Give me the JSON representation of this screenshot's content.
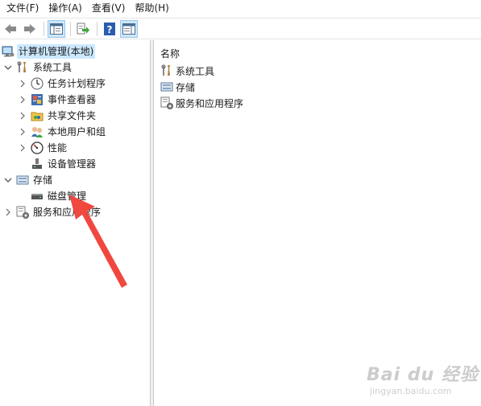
{
  "menubar": {
    "items": [
      {
        "label": "文件(F)"
      },
      {
        "label": "操作(A)"
      },
      {
        "label": "查看(V)"
      },
      {
        "label": "帮助(H)"
      }
    ]
  },
  "toolbar": {
    "buttons": [
      "back-arrow-icon",
      "forward-arrow-icon",
      "show-tree-icon",
      "export-icon",
      "help-icon",
      "properties-icon"
    ]
  },
  "tree": {
    "root": {
      "label": "计算机管理(本地)",
      "icon": "computer-management-icon"
    },
    "system_tools": {
      "label": "系统工具",
      "icon": "tools-icon"
    },
    "task_scheduler": {
      "label": "任务计划程序",
      "icon": "clock-icon"
    },
    "event_viewer": {
      "label": "事件查看器",
      "icon": "event-viewer-icon"
    },
    "shared_folders": {
      "label": "共享文件夹",
      "icon": "shared-folder-icon"
    },
    "local_users": {
      "label": "本地用户和组",
      "icon": "users-icon"
    },
    "performance": {
      "label": "性能",
      "icon": "performance-icon"
    },
    "device_manager": {
      "label": "设备管理器",
      "icon": "device-manager-icon"
    },
    "storage": {
      "label": "存储",
      "icon": "storage-icon"
    },
    "disk_management": {
      "label": "磁盘管理",
      "icon": "disk-icon"
    },
    "services": {
      "label": "服务和应用程序",
      "icon": "services-icon"
    }
  },
  "list": {
    "column_header": "名称",
    "items": [
      {
        "label": "系统工具"
      },
      {
        "label": "存储"
      },
      {
        "label": "服务和应用程序"
      }
    ]
  },
  "watermark": {
    "main": "Bai du 经验",
    "sub": "jingyan.baidu.com"
  },
  "colors": {
    "selection": "#cce8ff",
    "annotation_arrow": "#f0473e"
  }
}
